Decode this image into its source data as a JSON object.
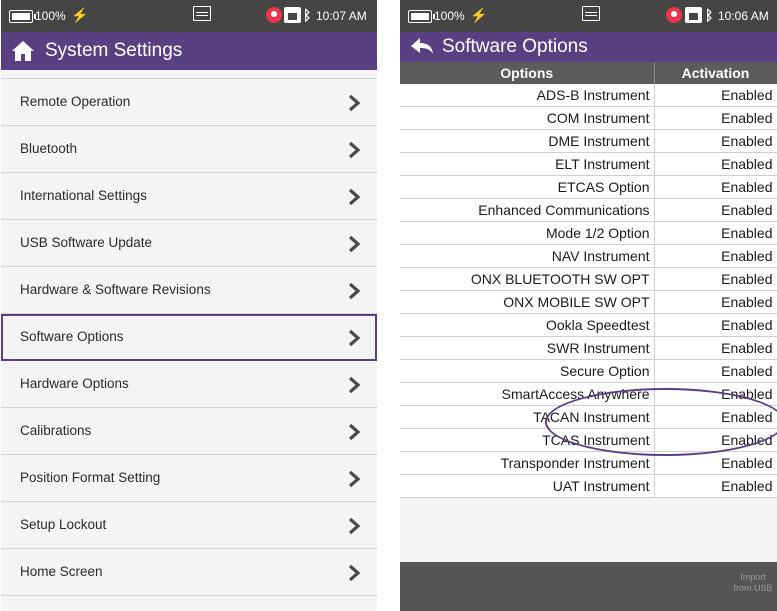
{
  "left_screen": {
    "status": {
      "battery": "100%",
      "time": "10:07 AM"
    },
    "title": "System Settings",
    "menu": [
      {
        "label": "Remote Operation"
      },
      {
        "label": "Bluetooth"
      },
      {
        "label": "International Settings"
      },
      {
        "label": "USB Software Update"
      },
      {
        "label": "Hardware & Software Revisions"
      },
      {
        "label": "Software Options",
        "selected": true
      },
      {
        "label": "Hardware Options"
      },
      {
        "label": "Calibrations"
      },
      {
        "label": "Position Format Setting"
      },
      {
        "label": "Setup Lockout"
      },
      {
        "label": "Home Screen"
      }
    ]
  },
  "right_screen": {
    "status": {
      "battery": "100%",
      "time": "10:06 AM"
    },
    "title": "Software Options",
    "columns": [
      "Options",
      "Activation"
    ],
    "rows": [
      {
        "option": "ADS-B Instrument",
        "activation": "Enabled"
      },
      {
        "option": "COM Instrument",
        "activation": "Enabled"
      },
      {
        "option": "DME Instrument",
        "activation": "Enabled"
      },
      {
        "option": "ELT Instrument",
        "activation": "Enabled"
      },
      {
        "option": "ETCAS Option",
        "activation": "Enabled"
      },
      {
        "option": "Enhanced Communications",
        "activation": "Enabled"
      },
      {
        "option": "Mode 1/2 Option",
        "activation": "Enabled"
      },
      {
        "option": "NAV Instrument",
        "activation": "Enabled"
      },
      {
        "option": "ONX BLUETOOTH SW OPT",
        "activation": "Enabled"
      },
      {
        "option": "ONX MOBILE SW OPT",
        "activation": "Enabled"
      },
      {
        "option": "Ookla Speedtest",
        "activation": "Enabled"
      },
      {
        "option": "SWR Instrument",
        "activation": "Enabled"
      },
      {
        "option": "Secure Option",
        "activation": "Enabled"
      },
      {
        "option": "SmartAccess Anywhere",
        "activation": "Enabled"
      },
      {
        "option": "TACAN Instrument",
        "activation": "Enabled"
      },
      {
        "option": "TCAS Instrument",
        "activation": "Enabled"
      },
      {
        "option": "Transponder Instrument",
        "activation": "Enabled"
      },
      {
        "option": "UAT Instrument",
        "activation": "Enabled"
      }
    ],
    "import_button": "Import from USB"
  },
  "colors": {
    "accent": "#5b3f83",
    "status_bar": "#454545",
    "table_header": "#5c5c5c",
    "bottom_bar": "#555555",
    "location": "#e8354c"
  },
  "icons": [
    "battery-icon",
    "charging-icon",
    "keyboard-icon",
    "location-icon",
    "home-status-icon",
    "bluetooth-icon",
    "home-icon",
    "back-arrow-icon",
    "chevron-right-icon"
  ]
}
